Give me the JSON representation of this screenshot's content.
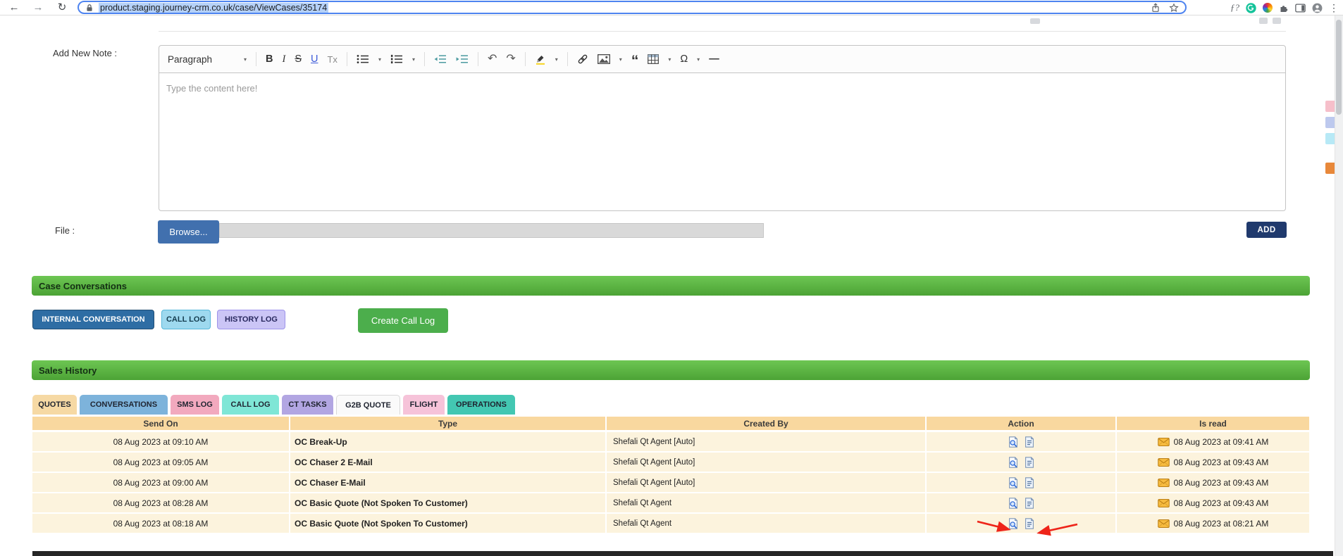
{
  "browser": {
    "url": "product.staging.journey-crm.co.uk/case/ViewCases/35174",
    "icons": {
      "back": "←",
      "forward": "→",
      "reload": "↻",
      "menu": "⋮",
      "fonts_ext": "ƒ?"
    }
  },
  "ui": {
    "chevron": "▾"
  },
  "note": {
    "label": "Add New Note :",
    "placeholder": "Type the content here!",
    "toolbar": {
      "paragraph": "Paragraph",
      "bold": "B",
      "italic": "I",
      "strikethrough": "S",
      "underline": "U",
      "remove_format": "Tx",
      "undo": "↶",
      "redo": "↷",
      "quote": "“",
      "special_char": "Ω",
      "horizontal_line": "—"
    }
  },
  "file": {
    "label": "File :",
    "browse": "Browse...",
    "add": "ADD"
  },
  "case_conversations": {
    "title": "Case Conversations",
    "buttons": [
      {
        "label": "INTERNAL CONVERSATION"
      },
      {
        "label": "CALL LOG"
      },
      {
        "label": "HISTORY LOG"
      }
    ],
    "create_call_log": "Create Call Log"
  },
  "sales_history": {
    "title": "Sales History",
    "tabs": [
      {
        "label": "QUOTES",
        "color": "#f6d9a4",
        "active": true
      },
      {
        "label": "CONVERSATIONS",
        "color": "#7db3db",
        "active": false
      },
      {
        "label": "SMS LOG",
        "color": "#f2a9be",
        "active": false
      },
      {
        "label": "CALL LOG",
        "color": "#7fe6d6",
        "active": false
      },
      {
        "label": "CT TASKS",
        "color": "#b2a6e2",
        "active": false
      },
      {
        "label": "G2B QUOTE",
        "color": "#fafafa",
        "active": false
      },
      {
        "label": "FLIGHT",
        "color": "#f6c3d9",
        "active": false
      },
      {
        "label": "OPERATIONS",
        "color": "#43c7b2",
        "active": false
      }
    ],
    "table": {
      "headers": [
        "Send On",
        "Type",
        "Created By",
        "Action",
        "Is read"
      ],
      "rows": [
        {
          "send_on": "08 Aug 2023 at 09:10 AM",
          "type": "OC Break-Up",
          "created_by": "Shefali Qt Agent [Auto]",
          "is_read": "08 Aug 2023 at 09:41 AM"
        },
        {
          "send_on": "08 Aug 2023 at 09:05 AM",
          "type": "OC Chaser 2 E-Mail",
          "created_by": "Shefali Qt Agent [Auto]",
          "is_read": "08 Aug 2023 at 09:43 AM"
        },
        {
          "send_on": "08 Aug 2023 at 09:00 AM",
          "type": "OC Chaser E-Mail",
          "created_by": "Shefali Qt Agent [Auto]",
          "is_read": "08 Aug 2023 at 09:43 AM"
        },
        {
          "send_on": "08 Aug 2023 at 08:28 AM",
          "type": "OC Basic Quote (Not Spoken To Customer)",
          "created_by": "Shefali Qt Agent",
          "is_read": "08 Aug 2023 at 09:43 AM"
        },
        {
          "send_on": "08 Aug 2023 at 08:18 AM",
          "type": "OC Basic Quote (Not Spoken To Customer)",
          "created_by": "Shefali Qt Agent",
          "is_read": "08 Aug 2023 at 08:21 AM"
        }
      ]
    }
  },
  "colors": {
    "section_header_green": "#54b33b",
    "table_header": "#f9d89f",
    "row_background": "#fcf3dd",
    "annotation_red": "#ee2419",
    "internal_conversation_blue": "#2e6da4",
    "create_call_log_green": "#4cae4c",
    "add_button_navy": "#203a6d"
  }
}
